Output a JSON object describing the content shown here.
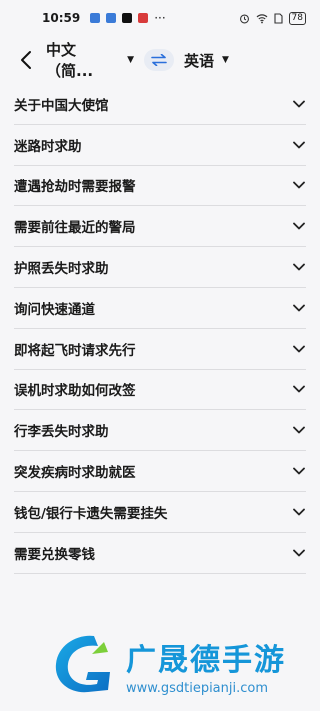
{
  "status_bar": {
    "time": "10:59",
    "more": "···",
    "battery": "78"
  },
  "header": {
    "source_language": "中文（简...",
    "target_language": "英语"
  },
  "phrase_categories": [
    {
      "label": "关于中国大使馆"
    },
    {
      "label": "迷路时求助"
    },
    {
      "label": "遭遇抢劫时需要报警"
    },
    {
      "label": "需要前往最近的警局"
    },
    {
      "label": "护照丢失时求助"
    },
    {
      "label": "询问快速通道"
    },
    {
      "label": "即将起飞时请求先行"
    },
    {
      "label": "误机时求助如何改签"
    },
    {
      "label": "行李丢失时求助"
    },
    {
      "label": "突发疾病时求助就医"
    },
    {
      "label": "钱包/银行卡遗失需要挂失"
    },
    {
      "label": "需要兑换零钱"
    }
  ],
  "watermark": {
    "title": "广晟德手游",
    "url": "www.gsdtiepianji.com"
  },
  "colors": {
    "accent": "#2a6fdb",
    "watermark_blue": "#1596d9"
  }
}
